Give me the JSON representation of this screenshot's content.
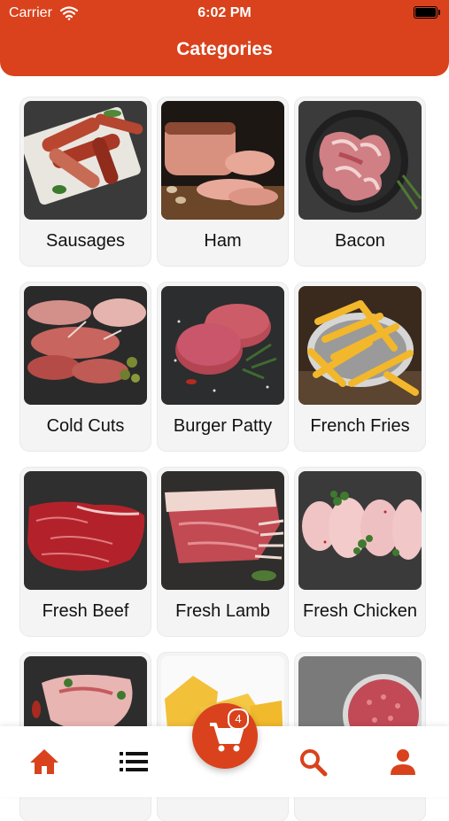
{
  "status_bar": {
    "carrier": "Carrier",
    "time": "6:02 PM"
  },
  "header": {
    "title": "Categories"
  },
  "colors": {
    "accent": "#d9421c"
  },
  "categories": [
    {
      "label": "Sausages"
    },
    {
      "label": "Ham"
    },
    {
      "label": "Bacon"
    },
    {
      "label": "Cold Cuts"
    },
    {
      "label": "Burger Patty"
    },
    {
      "label": "French Fries"
    },
    {
      "label": "Fresh Beef"
    },
    {
      "label": "Fresh Lamb"
    },
    {
      "label": "Fresh Chicken"
    },
    {
      "label": ""
    },
    {
      "label": ""
    },
    {
      "label": ""
    }
  ],
  "bottom_nav": {
    "items": [
      {
        "icon": "home-icon"
      },
      {
        "icon": "list-icon"
      },
      {
        "icon": "cart-icon"
      },
      {
        "icon": "search-icon"
      },
      {
        "icon": "profile-icon"
      }
    ],
    "cart_badge": "4"
  }
}
